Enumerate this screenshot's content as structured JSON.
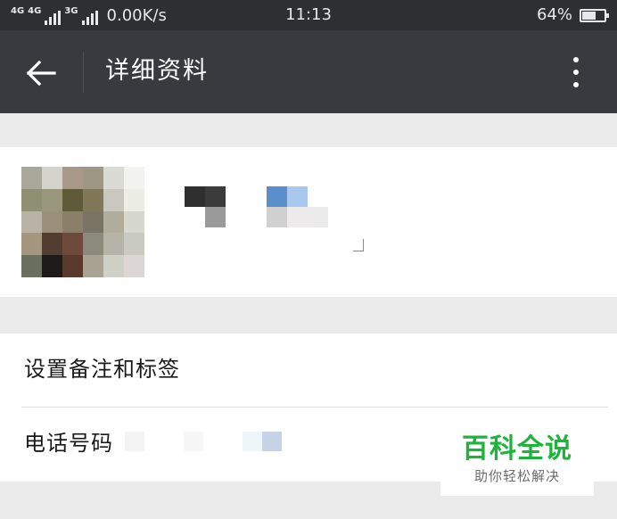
{
  "status_bar": {
    "network_1": "4G",
    "network_2": "4G",
    "network_3": "3G",
    "speed": "0.00K/s",
    "time": "11:13",
    "battery_percent": "64%",
    "battery_level": 0.64
  },
  "app_bar": {
    "title": "详细资料",
    "back_icon": "arrow-left-icon",
    "more_icon": "more-vertical-icon"
  },
  "profile": {
    "avatar_note": "pixelated-avatar",
    "name_note": "pixelated-name"
  },
  "settings": {
    "remark_label": "设置备注和标签",
    "phone_label": "电话号码"
  },
  "watermark": {
    "title": "百科全说",
    "subtitle": "助你轻松解决"
  },
  "colors": {
    "status_bar_bg": "#2e2f33",
    "app_bar_bg": "#393a3f",
    "page_bg": "#ebebeb",
    "card_bg": "#ffffff",
    "watermark_green": "#1db43a"
  }
}
